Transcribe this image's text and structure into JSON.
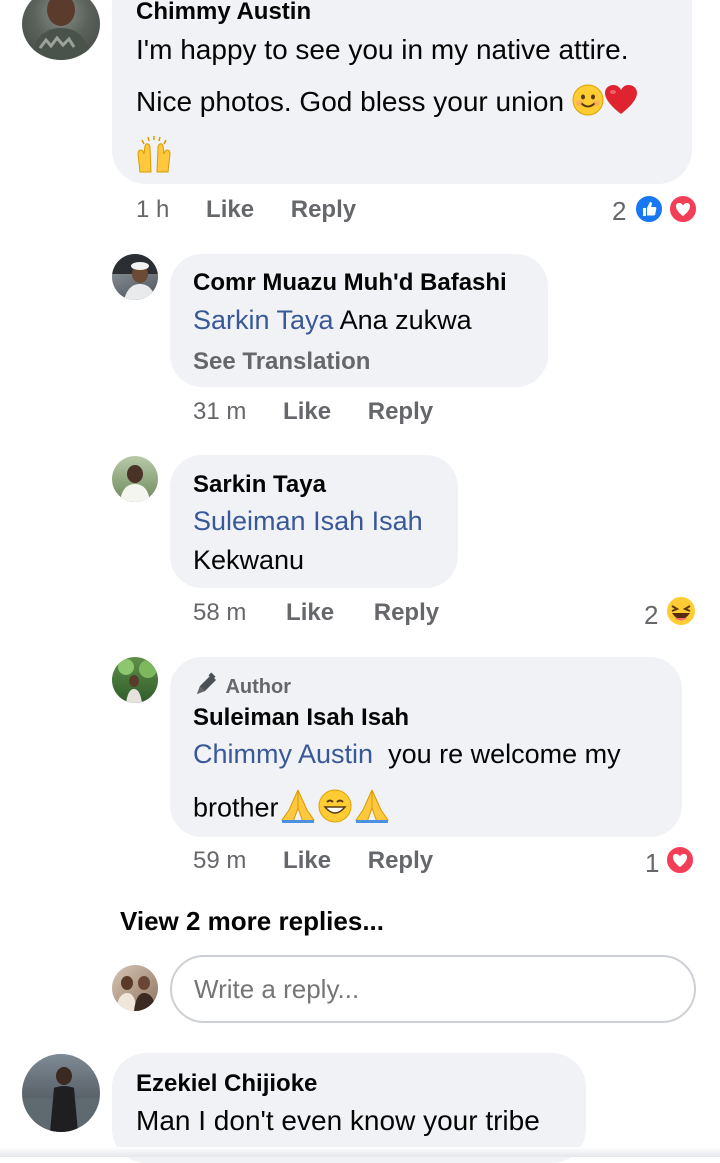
{
  "comments": [
    {
      "author": "Chimmy Austin",
      "line1": "I'm happy to see you in my native attire.",
      "line2": "Nice photos. God bless your union",
      "time": "1 h",
      "like": "Like",
      "reply": "Reply",
      "reaction_count": "2",
      "reactions": [
        "like-icon",
        "love-icon"
      ]
    },
    {
      "author": "Comr Muazu Muh'd Bafashi",
      "mention": "Sarkin Taya",
      "text": "Ana zukwa",
      "see_translation": "See Translation",
      "time": "31 m",
      "like": "Like",
      "reply": "Reply"
    },
    {
      "author": "Sarkin Taya",
      "mention": "Suleiman Isah Isah",
      "text": "Kekwanu",
      "time": "58 m",
      "like": "Like",
      "reply": "Reply",
      "reaction_count": "2",
      "reactions": [
        "haha-icon"
      ]
    },
    {
      "badge": "Author",
      "author": "Suleiman Isah Isah",
      "mention": "Chimmy Austin",
      "text": "you re welcome my",
      "text2": "brother",
      "time": "59 m",
      "like": "Like",
      "reply": "Reply",
      "reaction_count": "1",
      "reactions": [
        "love-icon"
      ]
    },
    {
      "author": "Ezekiel Chijioke",
      "text": "Man I don't even know your tribe"
    }
  ],
  "view_more": "View 2 more replies...",
  "reply_input": {
    "placeholder": "Write a reply..."
  },
  "colors": {
    "bubble": "#f0f2f5",
    "mention": "#385898",
    "meta": "#65676b",
    "like_blue": "#1877f2",
    "love_red": "#f33e58"
  }
}
